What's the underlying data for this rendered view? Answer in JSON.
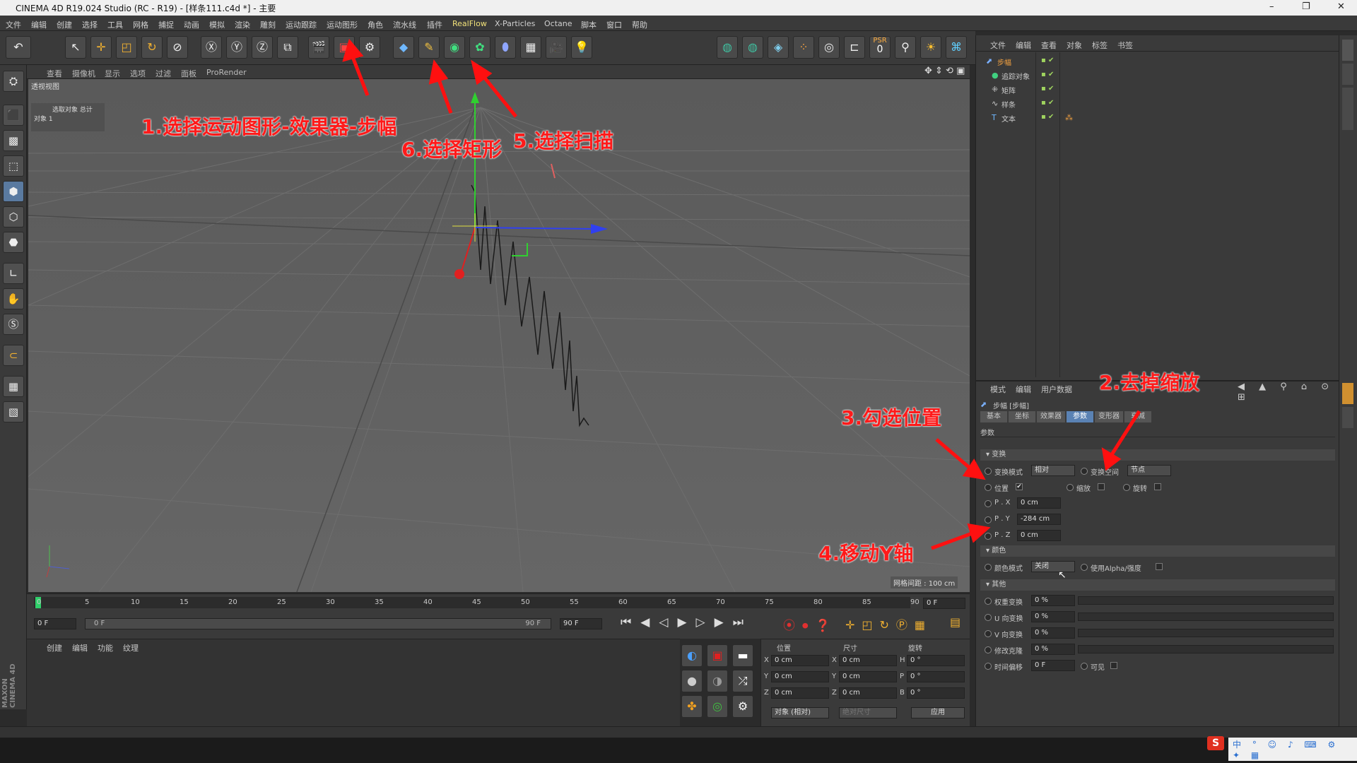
{
  "window": {
    "title": "CINEMA 4D R19.024 Studio (RC - R19) - [样条111.c4d *] - 主要"
  },
  "menu": [
    "文件",
    "编辑",
    "创建",
    "选择",
    "工具",
    "网格",
    "捕捉",
    "动画",
    "模拟",
    "渲染",
    "雕刻",
    "运动跟踪",
    "运动图形",
    "角色",
    "流水线",
    "插件",
    "RealFlow",
    "X-Particles",
    "Octane",
    "脚本",
    "窗口",
    "帮助"
  ],
  "viewport": {
    "menu": [
      "查看",
      "摄像机",
      "显示",
      "选项",
      "过滤",
      "面板",
      "ProRender"
    ],
    "label": "透视视图",
    "info_header": "选取对象 总计",
    "info_row": "对象  1",
    "grid_spacing": "网格间距 : 100 cm"
  },
  "toolbar": {
    "psr_label": "PSR",
    "psr_value": "0"
  },
  "annotations": {
    "a1": "1.选择运动图形-效果器-步幅",
    "a2": "2.去掉缩放",
    "a3": "3.勾选位置",
    "a4": "4.移动Y轴",
    "a5": "5.选择扫描",
    "a6": "6.选择矩形"
  },
  "timeline": {
    "ticks": [
      "0",
      "5",
      "10",
      "15",
      "20",
      "25",
      "30",
      "35",
      "40",
      "45",
      "50",
      "55",
      "60",
      "65",
      "70",
      "75",
      "80",
      "85",
      "90"
    ],
    "frame_field": "0 F",
    "start": "0 F",
    "range_start": "0 F",
    "range_end": "90 F",
    "end": "90 F"
  },
  "material_menu": [
    "创建",
    "编辑",
    "功能",
    "纹理"
  ],
  "coords": {
    "headers": [
      "位置",
      "尺寸",
      "旋转"
    ],
    "rows": [
      {
        "axis": "X",
        "pos": "0 cm",
        "size_axis": "X",
        "size": "0 cm",
        "rot_axis": "H",
        "rot": "0 °"
      },
      {
        "axis": "Y",
        "pos": "0 cm",
        "size_axis": "Y",
        "size": "0 cm",
        "rot_axis": "P",
        "rot": "0 °"
      },
      {
        "axis": "Z",
        "pos": "0 cm",
        "size_axis": "Z",
        "size": "0 cm",
        "rot_axis": "B",
        "rot": "0 °"
      }
    ],
    "mode": "对象 (相对)",
    "size_mode": "绝对尺寸",
    "apply": "应用"
  },
  "object_manager": {
    "menu": [
      "文件",
      "编辑",
      "查看",
      "对象",
      "标签",
      "书签"
    ],
    "items": [
      {
        "name": "步幅",
        "indent": 0
      },
      {
        "name": "追踪对象",
        "indent": 1
      },
      {
        "name": "矩阵",
        "indent": 1
      },
      {
        "name": "样条",
        "indent": 1
      },
      {
        "name": "文本",
        "indent": 1
      }
    ]
  },
  "attributes": {
    "menu": [
      "模式",
      "编辑",
      "用户数据"
    ],
    "object_title": "步幅 [步幅]",
    "tabs": [
      "基本",
      "坐标",
      "效果器",
      "参数",
      "变形器",
      "衰减"
    ],
    "active_tab": "参数",
    "section_params": "参数",
    "section_transform": "变换",
    "transform_mode_label": "变换模式",
    "transform_mode_value": "相对",
    "transform_space_label": "变换空间",
    "transform_space_value": "节点",
    "position_label": "位置",
    "scale_label": "缩放",
    "rotate_label": "旋转",
    "px_label": "P . X",
    "px": "0 cm",
    "py_label": "P . Y",
    "py": "-284 cm",
    "pz_label": "P . Z",
    "pz": "0 cm",
    "section_color": "颜色",
    "color_mode_label": "颜色模式",
    "color_mode_value": "关闭",
    "use_alpha_label": "使用Alpha/强度",
    "section_other": "其他",
    "weight_label": "权重变换",
    "weight": "0 %",
    "u_label": "U 向变换",
    "u": "0 %",
    "v_label": "V 向变换",
    "v": "0 %",
    "mod_label": "修改克隆",
    "mod": "0 %",
    "time_label": "时间偏移",
    "time": "0 F",
    "visible_label": "可见"
  },
  "brand": "MAXON CINEMA 4D"
}
